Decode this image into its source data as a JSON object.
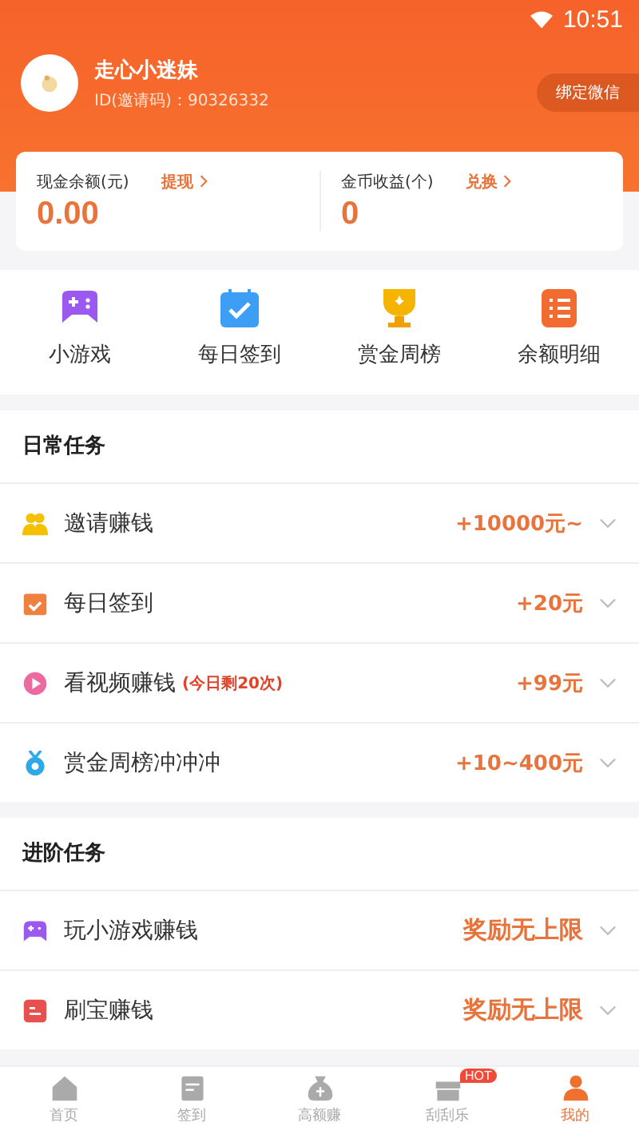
{
  "status_bar": {
    "time": "10:51"
  },
  "profile": {
    "name": "走心小迷妹",
    "id_text": "ID(邀请码)：90326332",
    "bind_button": "绑定微信"
  },
  "balances": [
    {
      "label": "现金余额(元)",
      "action": "提现",
      "value": "0.00"
    },
    {
      "label": "金币收益(个)",
      "action": "兑换",
      "value": "0"
    }
  ],
  "shortcuts": [
    {
      "kind": "game",
      "label": "小游戏"
    },
    {
      "kind": "calendar",
      "label": "每日签到"
    },
    {
      "kind": "trophy",
      "label": "赏金周榜"
    },
    {
      "kind": "list",
      "label": "余额明细"
    }
  ],
  "sections": [
    {
      "title": "日常任务",
      "tasks": [
        {
          "kind": "people",
          "name": "邀请赚钱",
          "reward": "+10000元~"
        },
        {
          "kind": "checkin",
          "name": "每日签到",
          "reward": "+20元"
        },
        {
          "kind": "play",
          "name": "看视频赚钱",
          "note": "(今日剩20次)",
          "reward": "+99元"
        },
        {
          "kind": "medal",
          "name": "赏金周榜冲冲冲",
          "reward": "+10~400元"
        }
      ]
    },
    {
      "title": "进阶任务",
      "tasks": [
        {
          "kind": "game",
          "name": "玩小游戏赚钱",
          "reward": "奖励无上限",
          "bold": true
        },
        {
          "kind": "card",
          "name": "刷宝赚钱",
          "reward": "奖励无上限",
          "bold": true
        }
      ]
    }
  ],
  "tabs": [
    {
      "kind": "home",
      "label": "首页",
      "selected": false
    },
    {
      "kind": "sign",
      "label": "签到",
      "selected": false
    },
    {
      "kind": "bag",
      "label": "高额赚",
      "selected": false
    },
    {
      "kind": "gift",
      "label": "刮刮乐",
      "selected": false,
      "badge": "HOT"
    },
    {
      "kind": "person",
      "label": "我的",
      "selected": true
    }
  ]
}
